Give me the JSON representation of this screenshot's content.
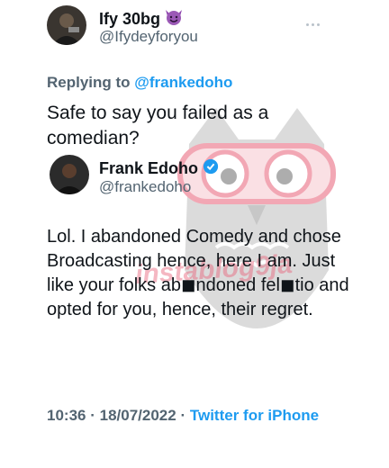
{
  "quoted": {
    "name": "Ify 30bg",
    "emoji": "😈",
    "handle": "@Ifydeyforyou",
    "replying_prefix": "Replying to",
    "replying_mention": "@frankedoho",
    "text": "Safe to say you failed as a comedian?"
  },
  "tweet": {
    "name": "Frank Edoho",
    "handle": "@frankedoho",
    "text": "Lol. I abandoned Comedy and chose Broadcasting hence, here I am. Just like your folks ab◼ndoned fel◼tio and opted for you, hence, their regret.",
    "time": "10:36",
    "date": "18/07/2022",
    "source": "Twitter for iPhone"
  },
  "watermark": "instablog9ja",
  "colors": {
    "accent": "#1d9bf0",
    "muted": "#536471",
    "watermark": "#e86078"
  },
  "icons": [
    "avatar",
    "devil-emoji-icon",
    "verified-badge-icon",
    "more-icon",
    "owl-watermark-icon"
  ]
}
